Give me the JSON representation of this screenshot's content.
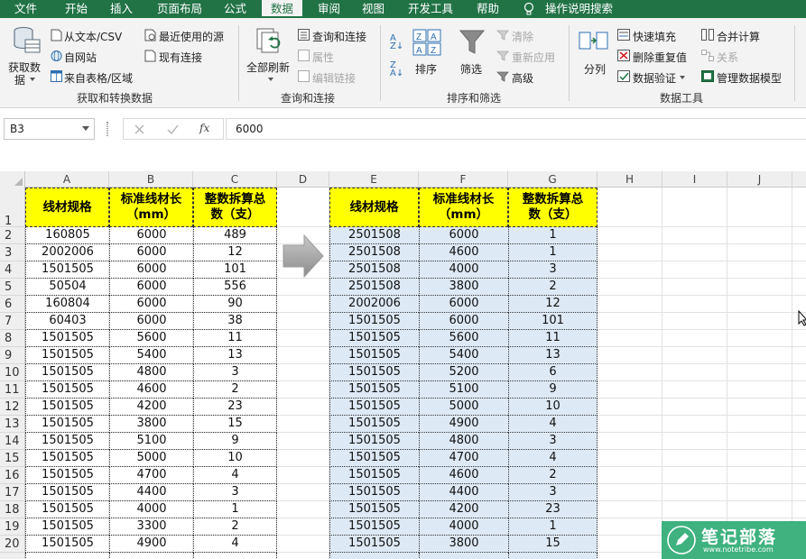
{
  "menu_tabs": [
    {
      "label": "文件",
      "active": false
    },
    {
      "label": "开始",
      "active": false
    },
    {
      "label": "插入",
      "active": false
    },
    {
      "label": "页面布局",
      "active": false
    },
    {
      "label": "公式",
      "active": false
    },
    {
      "label": "数据",
      "active": true
    },
    {
      "label": "审阅",
      "active": false
    },
    {
      "label": "视图",
      "active": false
    },
    {
      "label": "开发工具",
      "active": false
    },
    {
      "label": "帮助",
      "active": false
    }
  ],
  "tell_me": "操作说明搜索",
  "ribbon": {
    "get_data": {
      "big_button_line1": "获取数",
      "big_button_line2": "据",
      "from_text_csv": "从文本/CSV",
      "from_web": "自网站",
      "from_table": "来自表格/区域",
      "recent_sources": "最近使用的源",
      "existing_connections": "现有连接",
      "group_label": "获取和转换数据"
    },
    "queries": {
      "refresh_all": "全部刷新",
      "queries_connections": "查询和连接",
      "properties": "属性",
      "edit_links": "编辑链接",
      "group_label": "查询和连接"
    },
    "sort_filter": {
      "sort": "排序",
      "filter": "筛选",
      "clear": "清除",
      "reapply": "重新应用",
      "advanced": "高级",
      "group_label": "排序和筛选"
    },
    "data_tools": {
      "text_to_columns": "分列",
      "flash_fill": "快速填充",
      "remove_duplicates": "删除重复值",
      "data_validation": "数据验证",
      "consolidate": "合并计算",
      "relationships": "关系",
      "manage_data_model": "管理数据模型",
      "group_label": "数据工具"
    },
    "accent_color": "#217346"
  },
  "formula_bar": {
    "name_box": "B3",
    "formula": "6000"
  },
  "columns": [
    "A",
    "B",
    "C",
    "D",
    "E",
    "F",
    "G",
    "H",
    "I",
    "J"
  ],
  "row_numbers": [
    "1",
    "2",
    "3",
    "4",
    "5",
    "6",
    "7",
    "8",
    "9",
    "10",
    "11",
    "12",
    "13",
    "14",
    "15",
    "16",
    "17",
    "18",
    "19",
    "20"
  ],
  "left_table": {
    "headers": [
      [
        "线材规格"
      ],
      [
        "标准线材长",
        "（mm）"
      ],
      [
        "整数拆算总",
        "数（支）"
      ]
    ],
    "rows": [
      [
        "160805",
        "6000",
        "489"
      ],
      [
        "2002006",
        "6000",
        "12"
      ],
      [
        "1501505",
        "6000",
        "101"
      ],
      [
        "50504",
        "6000",
        "556"
      ],
      [
        "160804",
        "6000",
        "90"
      ],
      [
        "60403",
        "6000",
        "38"
      ],
      [
        "1501505",
        "5600",
        "11"
      ],
      [
        "1501505",
        "5400",
        "13"
      ],
      [
        "1501505",
        "4800",
        "3"
      ],
      [
        "1501505",
        "4600",
        "2"
      ],
      [
        "1501505",
        "4200",
        "23"
      ],
      [
        "1501505",
        "3800",
        "15"
      ],
      [
        "1501505",
        "5100",
        "9"
      ],
      [
        "1501505",
        "5000",
        "10"
      ],
      [
        "1501505",
        "4700",
        "4"
      ],
      [
        "1501505",
        "4400",
        "3"
      ],
      [
        "1501505",
        "4000",
        "1"
      ],
      [
        "1501505",
        "3300",
        "2"
      ],
      [
        "1501505",
        "4900",
        "4"
      ]
    ]
  },
  "right_table": {
    "headers": [
      [
        "线材规格"
      ],
      [
        "标准线材长",
        "（mm）"
      ],
      [
        "整数拆算总",
        "数（支）"
      ]
    ],
    "rows": [
      [
        "2501508",
        "6000",
        "1"
      ],
      [
        "2501508",
        "4600",
        "1"
      ],
      [
        "2501508",
        "4000",
        "3"
      ],
      [
        "2501508",
        "3800",
        "2"
      ],
      [
        "2002006",
        "6000",
        "12"
      ],
      [
        "1501505",
        "6000",
        "101"
      ],
      [
        "1501505",
        "5600",
        "11"
      ],
      [
        "1501505",
        "5400",
        "13"
      ],
      [
        "1501505",
        "5200",
        "6"
      ],
      [
        "1501505",
        "5100",
        "9"
      ],
      [
        "1501505",
        "5000",
        "10"
      ],
      [
        "1501505",
        "4900",
        "4"
      ],
      [
        "1501505",
        "4800",
        "3"
      ],
      [
        "1501505",
        "4700",
        "4"
      ],
      [
        "1501505",
        "4600",
        "2"
      ],
      [
        "1501505",
        "4400",
        "3"
      ],
      [
        "1501505",
        "4200",
        "23"
      ],
      [
        "1501505",
        "4000",
        "1"
      ],
      [
        "1501505",
        "3800",
        "15"
      ]
    ],
    "fill_color": "#dde9f5"
  },
  "watermark": {
    "title": "笔记部落",
    "url": "www.notetribe.com",
    "color": "#3fb27f"
  }
}
